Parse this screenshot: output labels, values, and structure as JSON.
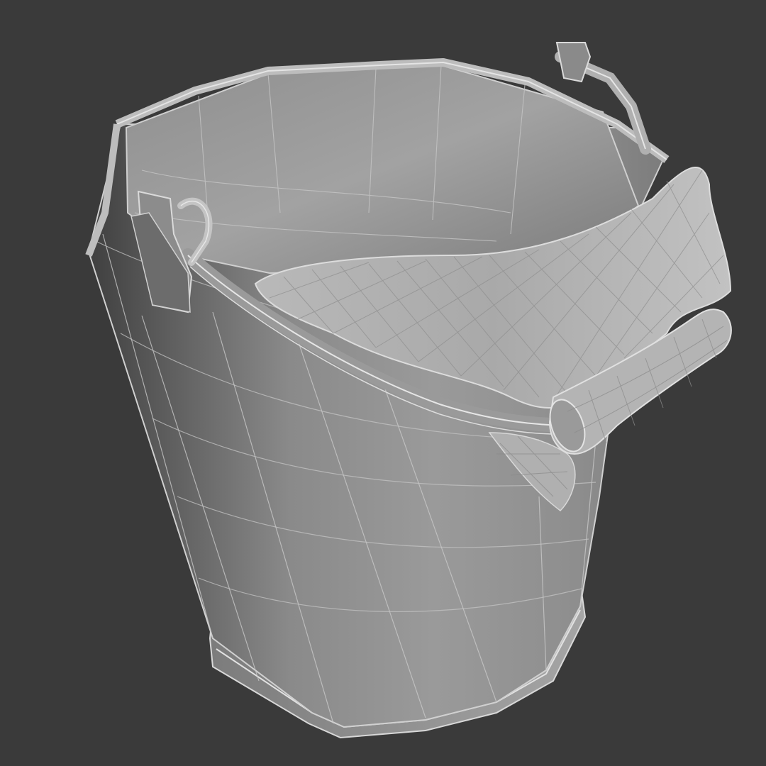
{
  "scene": {
    "subject": "wireframe-bucket-with-cloth",
    "background_color": "#3a3a3a",
    "surface_color": "#8c8c8c",
    "wire_color": "#cfcfcf",
    "view_mode": "shaded-with-edged-faces"
  }
}
